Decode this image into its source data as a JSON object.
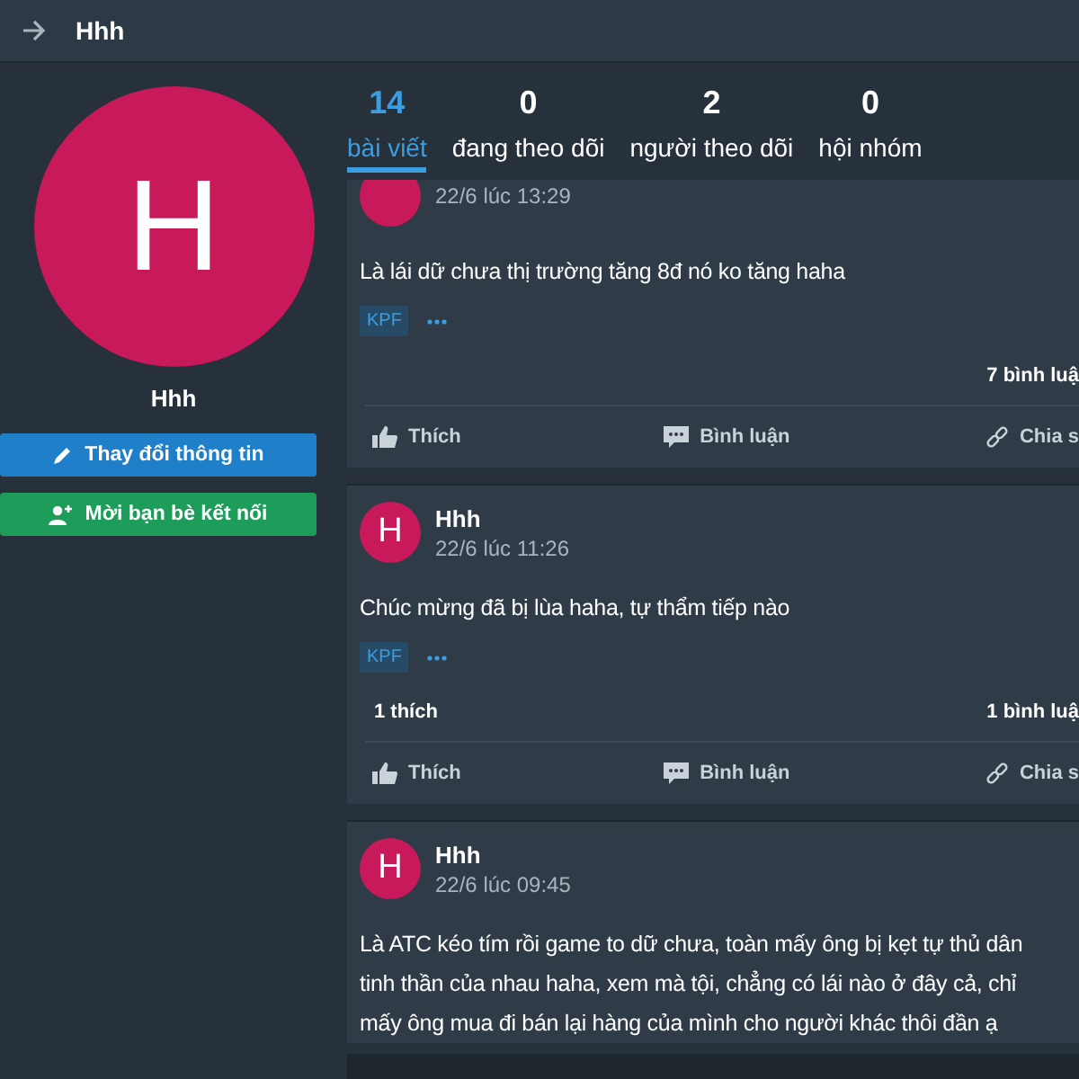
{
  "header": {
    "title": "Hhh"
  },
  "profile": {
    "avatar_letter": "H",
    "name": "Hhh",
    "buttons": [
      {
        "kind": "edit",
        "label": "Thay đổi thông tin"
      },
      {
        "kind": "invite",
        "label": "Mời bạn bè kết nối"
      }
    ]
  },
  "stats": [
    {
      "count": "14",
      "label": "bài viết",
      "selected": true
    },
    {
      "count": "0",
      "label": "đang theo dõi",
      "selected": false
    },
    {
      "count": "2",
      "label": "người theo dõi",
      "selected": false
    },
    {
      "count": "0",
      "label": "hội nhóm",
      "selected": false
    }
  ],
  "posts": [
    {
      "time": "22/6 lúc 13:29",
      "text": "Là lái dữ chưa thị trường tăng 8đ nó ko tăng haha",
      "tags": [
        "KPF"
      ],
      "comments": "7 bình luậ",
      "actions": [
        {
          "kind": "like",
          "label": "Thích"
        },
        {
          "kind": "comment",
          "label": "Bình luận"
        },
        {
          "kind": "share",
          "label": "Chia s"
        }
      ]
    },
    {
      "avatar_letter": "H",
      "name": "Hhh",
      "time": "22/6 lúc 11:26",
      "text": "Chúc mừng đã bị lùa haha, tự thẩm tiếp nào",
      "tags": [
        "KPF"
      ],
      "likes": "1 thích",
      "comments": "1 bình luậ",
      "actions": [
        {
          "kind": "like",
          "label": "Thích"
        },
        {
          "kind": "comment",
          "label": "Bình luận"
        },
        {
          "kind": "share",
          "label": "Chia s"
        }
      ]
    },
    {
      "avatar_letter": "H",
      "name": "Hhh",
      "time": "22/6 lúc 09:45",
      "text": "Là ATC kéo tím rồi game to dữ chưa, toàn mấy ông bị kẹt tự thủ dân\ntinh thần của nhau haha, xem mà tội, chẳng có lái nào ở đây cả, chỉ\nmấy ông mua đi bán lại hàng của mình cho người khác thôi đần ạ"
    }
  ]
}
